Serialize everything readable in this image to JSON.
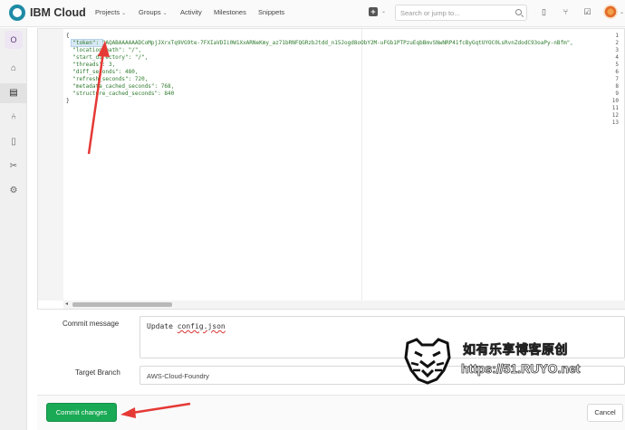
{
  "header": {
    "brand": "IBM Cloud",
    "nav": [
      {
        "label": "Projects",
        "caret": "⌄"
      },
      {
        "label": "Groups",
        "caret": "⌄"
      },
      {
        "label": "Activity"
      },
      {
        "label": "Milestones"
      },
      {
        "label": "Snippets"
      }
    ],
    "search_placeholder": "Search or jump to...",
    "plus_caret": "⌄",
    "avatar_caret": "⌄"
  },
  "sidebar": {
    "project_initial": "O",
    "items": [
      "home-icon",
      "file-icon",
      "merge-request-icon",
      "issues-icon",
      "scissors-icon",
      "settings-icon"
    ]
  },
  "editor": {
    "line_numbers": [
      "1",
      "2",
      "3",
      "4",
      "5",
      "6",
      "7",
      "8",
      "9",
      "10",
      "11",
      "12",
      "13"
    ],
    "lines": [
      "{",
      "  \"token\": \"AQABAAAAAADCoMpjJXrxTq9VG9te-7FXIaVDIi0W1XxARNeKmy_az71bRNFQGRzbJtdd_n15Jogd8oObY2M-uFGb1PTPzuEqbBmvSNwNRP41fcByGqtUYOC0LsRvnZdodC93oaPy-nBfm\",",
      "  \"location_path\": \"/\",",
      "  \"start_directory\": \"/\",",
      "  \"threads\": 3,",
      "  \"diff_seconds\": 480,",
      "  \"refresh_seconds\": 720,",
      "  \"metadata_cached_seconds\": 768,",
      "  \"structure_cached_seconds\": 840",
      "}",
      "",
      "",
      ""
    ],
    "scroll_left_arrow": "◂"
  },
  "form": {
    "commit_message_label": "Commit message",
    "commit_message_value": "Update config.json",
    "commit_message_prefix": "Update ",
    "commit_message_squiggle": "config.json",
    "target_branch_label": "Target Branch",
    "target_branch_value": "AWS-Cloud-Foundry"
  },
  "footer": {
    "commit_label": "Commit changes",
    "cancel_label": "Cancel"
  },
  "watermark": {
    "title": "如有乐享博客原创",
    "url": "https://51.RUYO.net"
  },
  "colors": {
    "accent_green": "#1aaa55",
    "annotation_red": "#e53935",
    "brand_teal": "#1f8aa6"
  }
}
